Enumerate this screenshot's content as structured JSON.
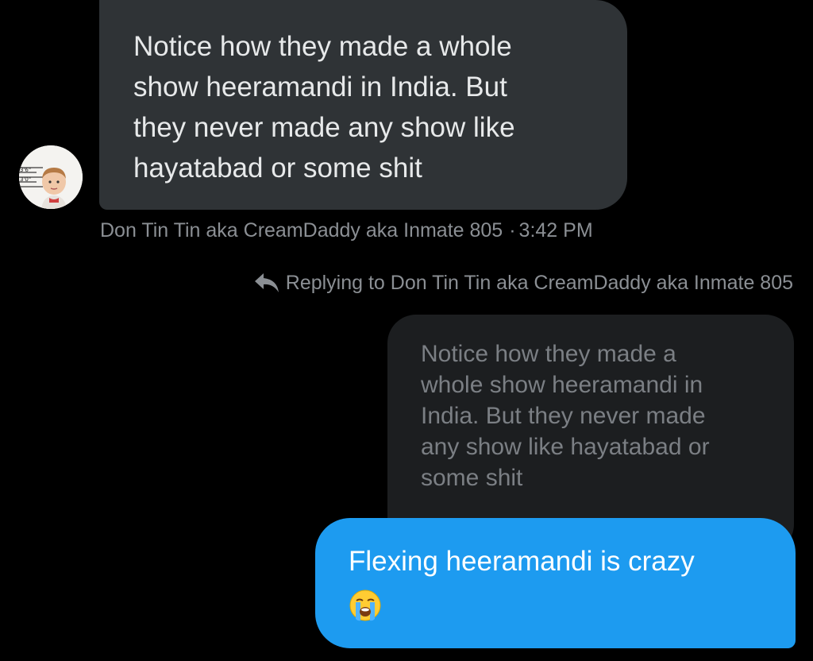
{
  "received_message": {
    "text_lines": [
      "Notice how they made a whole",
      "show heeramandi in India. But",
      "they never made any show like",
      "hayatabad or some shit"
    ],
    "sender": "Don Tin Tin aka CreamDaddy aka Inmate 805",
    "separator": "·",
    "time": "3:42 PM"
  },
  "reply_reference": {
    "icon": "reply-arrow-icon",
    "text": "Replying to Don Tin Tin aka CreamDaddy aka Inmate 805"
  },
  "quoted_message": {
    "text_lines": [
      "Notice how they made a",
      "whole show heeramandi in",
      "India. But they never made",
      "any show like hayatabad or",
      "some shit"
    ]
  },
  "sent_message": {
    "text": "Flexing heeramandi is crazy",
    "emoji": "loudly-crying-face-emoji"
  },
  "colors": {
    "background": "#000000",
    "received_bubble": "#2f3336",
    "quoted_bubble": "#1c1e20",
    "sent_bubble": "#1d9bf0",
    "meta_text": "#8b8f94"
  }
}
